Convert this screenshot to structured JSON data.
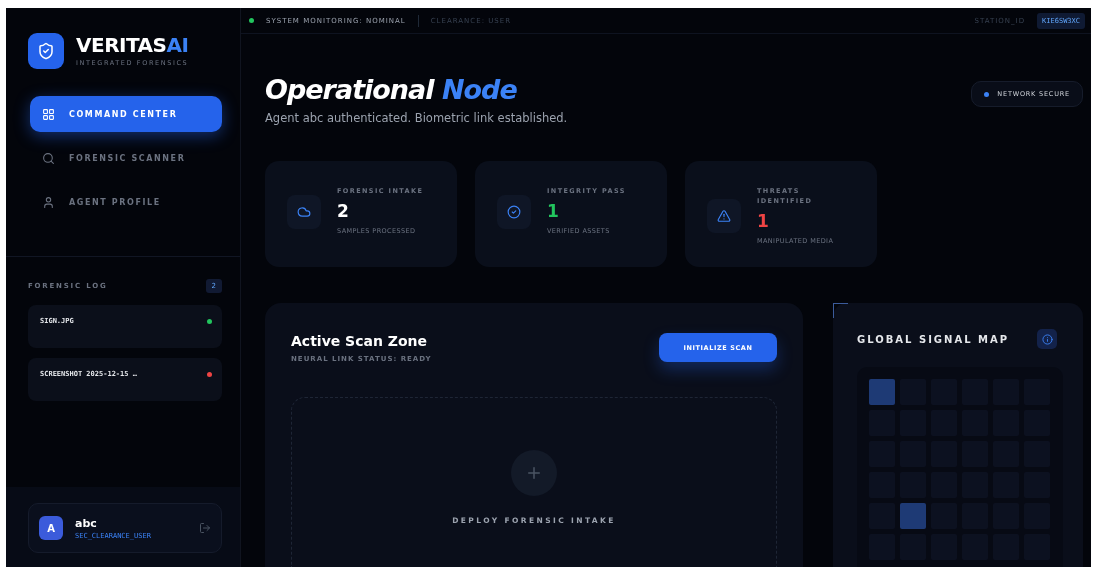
{
  "brand": {
    "name": "VERITAS",
    "accent": "AI",
    "tagline": "INTEGRATED FORENSICS"
  },
  "nav": [
    {
      "kind": "grid",
      "label": "COMMAND CENTER",
      "selected": true
    },
    {
      "kind": "search",
      "label": "FORENSIC SCANNER",
      "selected": false
    },
    {
      "kind": "user",
      "label": "AGENT PROFILE",
      "selected": false
    }
  ],
  "log": {
    "title": "FORENSIC LOG",
    "count": "2",
    "items": [
      {
        "name": "SIGN.JPG",
        "color": "#22c55e"
      },
      {
        "name": "SCREENSHOT 2025-12-15 …",
        "color": "#ef4444"
      }
    ]
  },
  "user": {
    "initial": "A",
    "name": "abc",
    "role": "SEC_CLEARANCE_USER"
  },
  "topbar": {
    "status": "SYSTEM MONITORING: NOMINAL",
    "clearance": "CLEARANCE: USER",
    "station_label": "STATION_ID",
    "station_id": "KIE6SW3XC"
  },
  "header": {
    "title": "Operational",
    "title_accent": "Node",
    "subtitle": "Agent abc authenticated. Biometric link established.",
    "badge": "NETWORK SECURE"
  },
  "stats": [
    {
      "kind": "intake",
      "label": "FORENSIC INTAKE",
      "value": "2",
      "note": "SAMPLES PROCESSED",
      "color": "#ffffff"
    },
    {
      "kind": "check",
      "label": "INTEGRITY PASS",
      "value": "1",
      "note": "VERIFIED ASSETS",
      "color": "#22c55e"
    },
    {
      "kind": "warning",
      "label": "THREATS IDENTIFIED",
      "value": "1",
      "note": "MANIPULATED MEDIA",
      "color": "#ef4444"
    }
  ],
  "scan": {
    "title": "Active Scan Zone",
    "status": "NEURAL LINK STATUS: READY",
    "button": "INITIALIZE SCAN",
    "drop_label": "DEPLOY FORENSIC INTAKE"
  },
  "signal_map": {
    "title": "GLOBAL SIGNAL MAP",
    "rows": [
      {
        "cells": [
          {
            "active": true
          },
          {
            "active": false
          },
          {
            "active": false
          },
          {
            "active": false
          },
          {
            "active": false
          },
          {
            "active": false
          }
        ]
      },
      {
        "cells": [
          {
            "active": false
          },
          {
            "active": false
          },
          {
            "active": false
          },
          {
            "active": false
          },
          {
            "active": false
          },
          {
            "active": false
          }
        ]
      },
      {
        "cells": [
          {
            "active": false
          },
          {
            "active": false
          },
          {
            "active": false
          },
          {
            "active": false
          },
          {
            "active": false
          },
          {
            "active": false
          }
        ]
      },
      {
        "cells": [
          {
            "active": false
          },
          {
            "active": false
          },
          {
            "active": false
          },
          {
            "active": false
          },
          {
            "active": false
          },
          {
            "active": false
          }
        ]
      },
      {
        "cells": [
          {
            "active": false
          },
          {
            "active": true
          },
          {
            "active": false
          },
          {
            "active": false
          },
          {
            "active": false
          },
          {
            "active": false
          }
        ]
      },
      {
        "cells": [
          {
            "active": false
          },
          {
            "active": false
          },
          {
            "active": false
          },
          {
            "active": false
          },
          {
            "active": false
          },
          {
            "active": false
          }
        ]
      }
    ]
  }
}
